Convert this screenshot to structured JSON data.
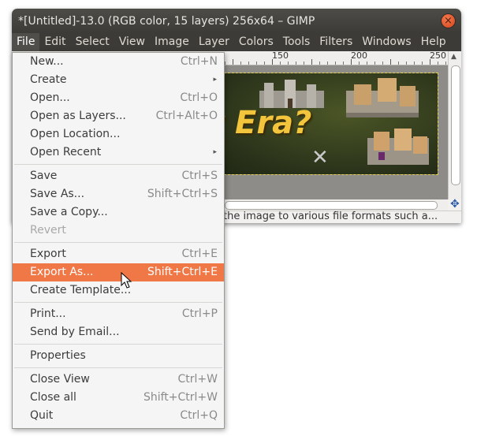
{
  "window": {
    "title": "*[Untitled]-13.0 (RGB color, 15 layers) 256x64 – GIMP",
    "close_glyph": "×"
  },
  "menubar": [
    "File",
    "Edit",
    "Select",
    "View",
    "Image",
    "Layer",
    "Colors",
    "Tools",
    "Filters",
    "Windows",
    "Help"
  ],
  "ruler": {
    "labels": [
      "150",
      "200",
      "250"
    ]
  },
  "canvas": {
    "image_text": "t Era?"
  },
  "statusbar": {
    "text": "the image to various file formats such a..."
  },
  "file_menu": {
    "groups": [
      [
        {
          "label": "New...",
          "accel": "Ctrl+N"
        },
        {
          "label": "Create",
          "submenu": true
        },
        {
          "label": "Open...",
          "accel": "Ctrl+O"
        },
        {
          "label": "Open as Layers...",
          "accel": "Ctrl+Alt+O"
        },
        {
          "label": "Open Location...",
          "accel": ""
        },
        {
          "label": "Open Recent",
          "submenu": true
        }
      ],
      [
        {
          "label": "Save",
          "accel": "Ctrl+S"
        },
        {
          "label": "Save As...",
          "accel": "Shift+Ctrl+S"
        },
        {
          "label": "Save a Copy...",
          "accel": ""
        },
        {
          "label": "Revert",
          "accel": "",
          "disabled": true
        }
      ],
      [
        {
          "label": "Export",
          "accel": "Ctrl+E"
        },
        {
          "label": "Export As...",
          "accel": "Shift+Ctrl+E",
          "highlighted": true
        },
        {
          "label": "Create Template...",
          "accel": ""
        }
      ],
      [
        {
          "label": "Print...",
          "accel": "Ctrl+P"
        },
        {
          "label": "Send by Email...",
          "accel": ""
        }
      ],
      [
        {
          "label": "Properties",
          "accel": ""
        }
      ],
      [
        {
          "label": "Close View",
          "accel": "Ctrl+W"
        },
        {
          "label": "Close all",
          "accel": "Shift+Ctrl+W"
        },
        {
          "label": "Quit",
          "accel": "Ctrl+Q"
        }
      ]
    ]
  },
  "colors": {
    "highlight": "#f07746",
    "titlebar": "#3c3b37",
    "close_button": "#e5582a",
    "image_text": "#f2c53d"
  }
}
